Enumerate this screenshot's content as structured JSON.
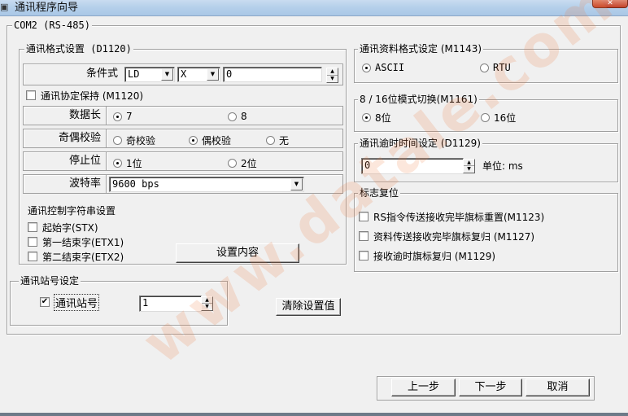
{
  "window": {
    "title": "通讯程序向导",
    "close_label": "✕"
  },
  "com_group": {
    "legend": "COM2 (RS-485)"
  },
  "format_group": {
    "legend": "通讯格式设置 (D1120)",
    "condition": {
      "label": "条件式",
      "op_value": "LD",
      "device_value": "X",
      "number_value": "0"
    },
    "protocol_hold": {
      "label": "通讯协定保持 (M1120)",
      "checked": false
    },
    "data_length": {
      "label": "数据长",
      "options": [
        {
          "label": "7",
          "selected": true
        },
        {
          "label": "8",
          "selected": false
        }
      ]
    },
    "parity": {
      "label": "奇偶校验",
      "options": [
        {
          "label": "奇校验",
          "selected": false
        },
        {
          "label": "偶校验",
          "selected": true
        },
        {
          "label": "无",
          "selected": false
        }
      ]
    },
    "stop_bits": {
      "label": "停止位",
      "options": [
        {
          "label": "1位",
          "selected": true
        },
        {
          "label": "2位",
          "selected": false
        }
      ]
    },
    "baud_rate": {
      "label": "波特率",
      "value": "9600 bps"
    },
    "control_chars": {
      "title": "通讯控制字符串设置",
      "items": [
        {
          "label": "起始字(STX)",
          "checked": false
        },
        {
          "label": "第一结束字(ETX1)",
          "checked": false
        },
        {
          "label": "第二结束字(ETX2)",
          "checked": false
        }
      ],
      "set_content_button": "设置内容"
    }
  },
  "station_group": {
    "legend": "通讯站号设定",
    "station": {
      "label": "通讯站号",
      "checked": true,
      "value": "1"
    }
  },
  "clear_button": "清除设置值",
  "data_format_group": {
    "legend": "通讯资料格式设定 (M1143)",
    "options": [
      {
        "label": "ASCII",
        "selected": true
      },
      {
        "label": "RTU",
        "selected": false
      }
    ]
  },
  "bit_mode_group": {
    "legend": "8 / 16位模式切换(M1161)",
    "options": [
      {
        "label": "8位",
        "selected": true
      },
      {
        "label": "16位",
        "selected": false
      }
    ]
  },
  "timeout_group": {
    "legend": "通讯逾时时间设定 (D1129)",
    "value": "0",
    "unit_label": "单位: ms"
  },
  "flag_reset_group": {
    "legend": "标志复位",
    "items": [
      {
        "label": "RS指令传送接收完毕旗标重置(M1123)",
        "checked": false
      },
      {
        "label": "资料传送接收完毕旗标复归 (M1127)",
        "checked": false
      },
      {
        "label": "接收逾时旗标复归 (M1129)",
        "checked": false
      }
    ]
  },
  "nav": {
    "prev": "上一步",
    "next": "下一步",
    "cancel": "取消"
  },
  "watermark": "www.datale.com"
}
